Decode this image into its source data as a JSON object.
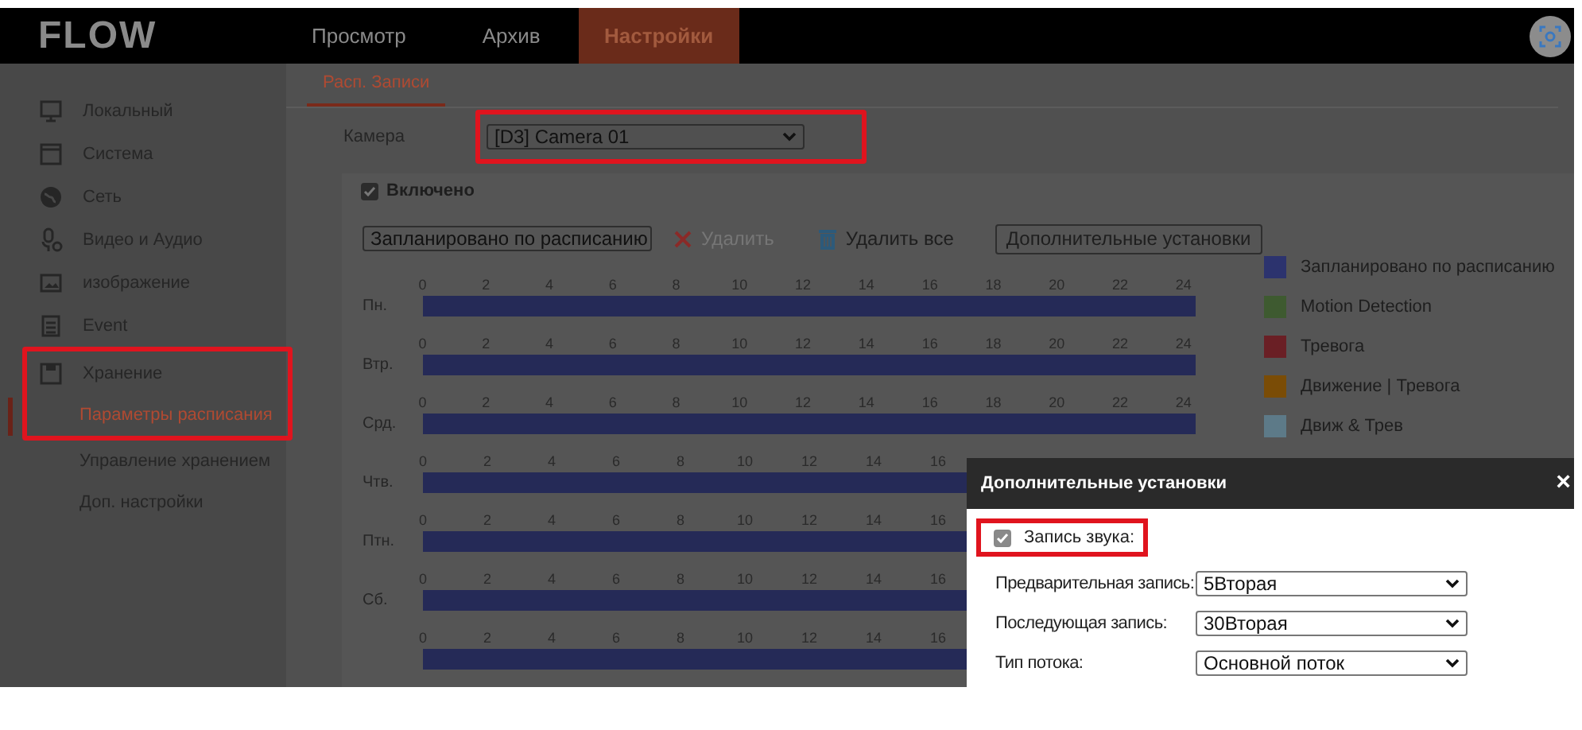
{
  "header": {
    "logo": "FLOW",
    "nav": [
      {
        "label": "Просмотр",
        "selected": false
      },
      {
        "label": "Архив",
        "selected": false
      },
      {
        "label": "Настройки",
        "selected": true
      }
    ]
  },
  "sidebar": {
    "items": [
      {
        "kind": "monitor",
        "label": "Локальный",
        "highlighted": false
      },
      {
        "kind": "window",
        "label": "Система",
        "highlighted": false
      },
      {
        "kind": "globe",
        "label": "Сеть",
        "highlighted": false
      },
      {
        "kind": "mic",
        "label": "Видео и Аудио",
        "highlighted": false
      },
      {
        "kind": "image",
        "label": "изображение",
        "highlighted": false
      },
      {
        "kind": "calendar",
        "label": "Event",
        "highlighted": false
      },
      {
        "kind": "disk",
        "label": "Хранение",
        "highlighted": true,
        "children": [
          {
            "label": "Параметры расписания",
            "selected": true
          },
          {
            "label": "Управление хранением",
            "selected": false
          },
          {
            "label": "Доп. настройки",
            "selected": false
          }
        ]
      }
    ]
  },
  "tabs": [
    {
      "label": "Расп. Записи",
      "selected": true
    }
  ],
  "camera": {
    "label": "Камера",
    "value": "[D3] Camera 01",
    "highlighted": true
  },
  "enabled": {
    "label": "Включено",
    "checked": true
  },
  "toolbar": {
    "mode": "Запланировано по расписанию",
    "delete": {
      "label": "Удалить",
      "disabled": true
    },
    "delete_all": {
      "label": "Удалить все",
      "disabled": false
    },
    "advanced": "Дополнительные установки"
  },
  "schedule": {
    "days": [
      {
        "label": "Пн.",
        "ticks": [
          "0",
          "2",
          "4",
          "6",
          "8",
          "10",
          "12",
          "14",
          "16",
          "18",
          "20",
          "22",
          "24"
        ]
      },
      {
        "label": "Втр.",
        "ticks": [
          "0",
          "2",
          "4",
          "6",
          "8",
          "10",
          "12",
          "14",
          "16",
          "18",
          "20",
          "22",
          "24"
        ]
      },
      {
        "label": "Срд.",
        "ticks": [
          "0",
          "2",
          "4",
          "6",
          "8",
          "10",
          "12",
          "14",
          "16",
          "18",
          "20",
          "22",
          "24"
        ]
      },
      {
        "label": "Чтв.",
        "ticks": [
          "0",
          "2",
          "4",
          "6",
          "8",
          "10",
          "12",
          "14",
          "16"
        ]
      },
      {
        "label": "Птн.",
        "ticks": [
          "0",
          "2",
          "4",
          "6",
          "8",
          "10",
          "12",
          "14",
          "16"
        ]
      },
      {
        "label": "Сб.",
        "ticks": [
          "0",
          "2",
          "4",
          "6",
          "8",
          "10",
          "12",
          "14",
          "16"
        ]
      },
      {
        "ticks": [
          "0",
          "2",
          "4",
          "6",
          "8",
          "10",
          "12",
          "14",
          "16"
        ]
      }
    ]
  },
  "legend": [
    {
      "label": "Запланировано по расписанию",
      "color": "#2c336e"
    },
    {
      "label": "Motion Detection",
      "color": "#3e5a30"
    },
    {
      "label": "Тревога",
      "color": "#6a1f25"
    },
    {
      "label": "Движение | Тревога",
      "color": "#7a4c06"
    },
    {
      "label": "Движ & Трев",
      "color": "#5d7a88"
    }
  ],
  "dialog": {
    "title": "Дополнительные установки",
    "close": "×",
    "audio": {
      "label": "Запись звука:",
      "checked": true,
      "highlighted": true
    },
    "fields": [
      {
        "label": "Предварительная запись:",
        "value": "5Вторая"
      },
      {
        "label": "Последующая запись:",
        "value": "30Вторая"
      },
      {
        "label": "Тип потока:",
        "value": "Основной поток"
      }
    ]
  }
}
